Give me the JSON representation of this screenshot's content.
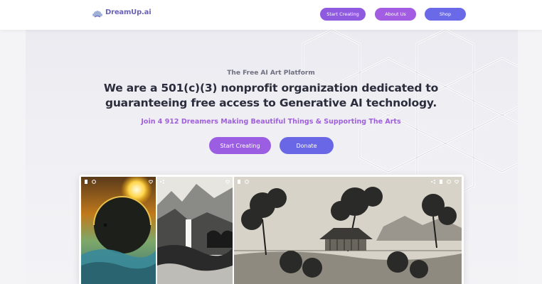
{
  "brand": {
    "name": "DreamUp.ai"
  },
  "nav": {
    "start_label": "Start Creating",
    "about_label": "About Us",
    "shop_label": "Shop"
  },
  "hero": {
    "kicker": "The Free AI Art Platform",
    "headline": "We are a 501(c)(3) nonprofit organization dedicated to guaranteeing free access to Generative AI technology.",
    "subline": "Join 4 912 Dreamers Making Beautiful Things & Supporting The Arts",
    "start_label": "Start Creating",
    "donate_label": "Donate"
  },
  "gallery": {
    "tiles": [
      {
        "subject": "eclipse-over-ocean",
        "icons": [
          "copy-icon",
          "remix-icon",
          "heart-icon"
        ]
      },
      {
        "subject": "ink-waterfall-landscape",
        "icons": [
          "share-icon",
          "heart-icon"
        ]
      },
      {
        "subject": "ink-pagoda-garden",
        "icons": [
          "copy-icon",
          "remix-icon",
          "share-icon",
          "copy-icon",
          "remix-icon",
          "heart-icon"
        ]
      }
    ]
  },
  "colors": {
    "brand_purple": "#8f5ae0",
    "about_purple": "#a35de2",
    "indigo": "#6a6ae8",
    "headline": "#2b2d3c",
    "subline": "#a060dc"
  }
}
